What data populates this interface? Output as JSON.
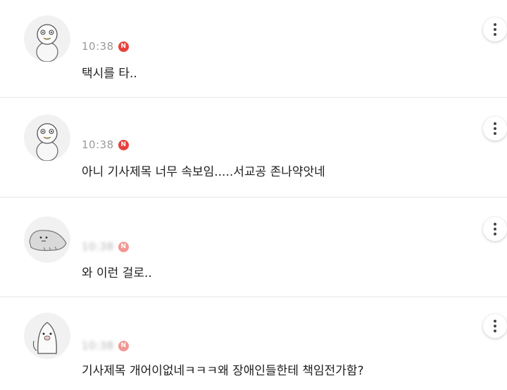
{
  "comments": [
    {
      "time": "10:38",
      "badge": "N",
      "text": "택시를 타..",
      "avatar": "duck-avatar-icon"
    },
    {
      "time": "10:38",
      "badge": "N",
      "text": "아니 기사제목 너무 속보임.....서교공 존나약앗네",
      "avatar": "duck-avatar-icon"
    },
    {
      "time": "10:38",
      "badge": "N",
      "text": "와 이런 걸로..",
      "avatar": "seal-avatar-icon"
    },
    {
      "time": "10:38",
      "badge": "N",
      "text": "기사제목 개어이없네ㅋㅋㅋ왜 장애인들한테 책임전가함?",
      "avatar": "penguin-avatar-icon"
    }
  ],
  "colors": {
    "badge": "#e8413c",
    "divider": "#e6e6e6",
    "time": "#9a9a9a"
  }
}
